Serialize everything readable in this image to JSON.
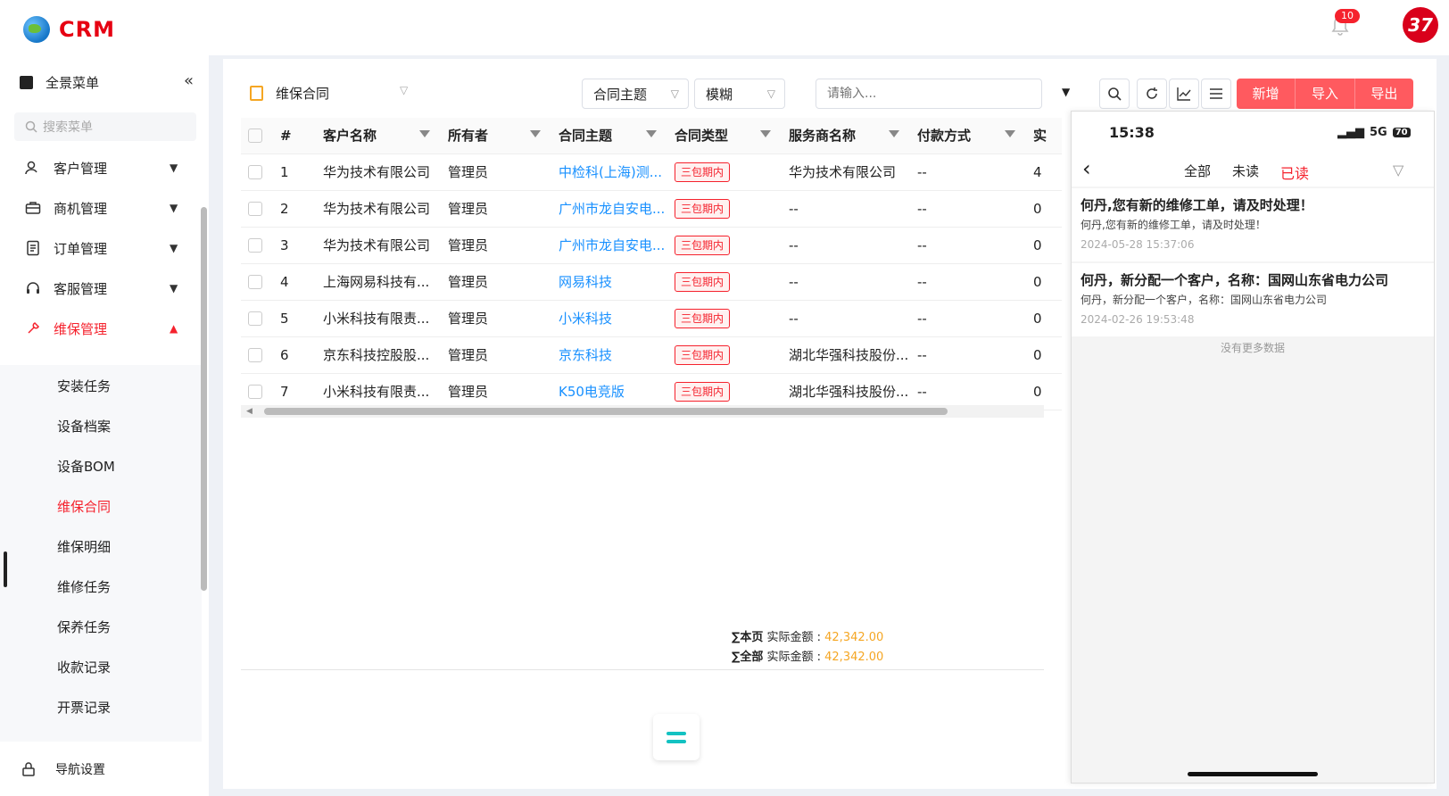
{
  "app": {
    "logo_text": "CRM",
    "notification_count": "10",
    "avatar_text": "37"
  },
  "sidebar": {
    "header_label": "全景菜单",
    "collapse_icon": "«",
    "search_placeholder": "搜索菜单",
    "menu": [
      {
        "label": "客户管理",
        "icon": "user-icon"
      },
      {
        "label": "商机管理",
        "icon": "briefcase-icon"
      },
      {
        "label": "订单管理",
        "icon": "order-icon"
      },
      {
        "label": "客服管理",
        "icon": "headset-icon"
      },
      {
        "label": "维保管理",
        "icon": "maintenance-icon",
        "expanded": true
      }
    ],
    "submenu": [
      "安装任务",
      "设备档案",
      "设备BOM",
      "维保合同",
      "维保明细",
      "维修任务",
      "保养任务",
      "收款记录",
      "开票记录"
    ],
    "active_submenu": "维保合同",
    "nav_setting_label": "导航设置"
  },
  "toolbar": {
    "title": "维保合同",
    "field_select": "合同主题",
    "match_select": "模糊",
    "search_placeholder": "请输入...",
    "buttons": {
      "add": "新增",
      "import": "导入",
      "export": "导出"
    }
  },
  "table": {
    "columns": [
      "#",
      "客户名称",
      "所有者",
      "合同主题",
      "合同类型",
      "服务商名称",
      "付款方式",
      "实"
    ],
    "rows": [
      {
        "no": "1",
        "customer": "华为技术有限公司",
        "owner": "管理员",
        "subject": "中检科(上海)测...",
        "type": "三包期内",
        "provider": "华为技术有限公司",
        "payment": "--",
        "extra": "4"
      },
      {
        "no": "2",
        "customer": "华为技术有限公司",
        "owner": "管理员",
        "subject": "广州市龙自安电...",
        "type": "三包期内",
        "provider": "--",
        "payment": "--",
        "extra": "0"
      },
      {
        "no": "3",
        "customer": "华为技术有限公司",
        "owner": "管理员",
        "subject": "广州市龙自安电...",
        "type": "三包期内",
        "provider": "--",
        "payment": "--",
        "extra": "0"
      },
      {
        "no": "4",
        "customer": "上海网易科技有...",
        "owner": "管理员",
        "subject": "网易科技",
        "type": "三包期内",
        "provider": "--",
        "payment": "--",
        "extra": "0"
      },
      {
        "no": "5",
        "customer": "小米科技有限责...",
        "owner": "管理员",
        "subject": "小米科技",
        "type": "三包期内",
        "provider": "--",
        "payment": "--",
        "extra": "0"
      },
      {
        "no": "6",
        "customer": "京东科技控股股...",
        "owner": "管理员",
        "subject": "京东科技",
        "type": "三包期内",
        "provider": "湖北华强科技股份...",
        "payment": "--",
        "extra": "0"
      },
      {
        "no": "7",
        "customer": "小米科技有限责...",
        "owner": "管理员",
        "subject": "K50电竞版",
        "type": "三包期内",
        "provider": "湖北华强科技股份...",
        "payment": "--",
        "extra": "0"
      }
    ]
  },
  "totals": {
    "page_label": "∑本页",
    "all_label": "∑全部",
    "field_label": "实际金额 :",
    "page_value": "42,342.00",
    "all_value": "42,342.00"
  },
  "phone": {
    "time": "15:38",
    "network": "5G",
    "battery": "70",
    "tabs": [
      "全部",
      "未读",
      "已读"
    ],
    "active_tab": "已读",
    "messages": [
      {
        "title": "何丹,您有新的维修工单，请及时处理！",
        "body": "何丹,您有新的维修工单，请及时处理！",
        "date": "2024-05-28 15:37:06"
      },
      {
        "title": "何丹，新分配一个客户，名称：国网山东省电力公司",
        "body": "何丹，新分配一个客户，名称：国网山东省电力公司",
        "date": "2024-02-26 19:53:48"
      }
    ],
    "no_more": "没有更多数据"
  },
  "colors": {
    "accent": "#f5222d",
    "link": "#1890ff",
    "amount": "#f5a623",
    "primary_button": "#ff5a5f"
  }
}
